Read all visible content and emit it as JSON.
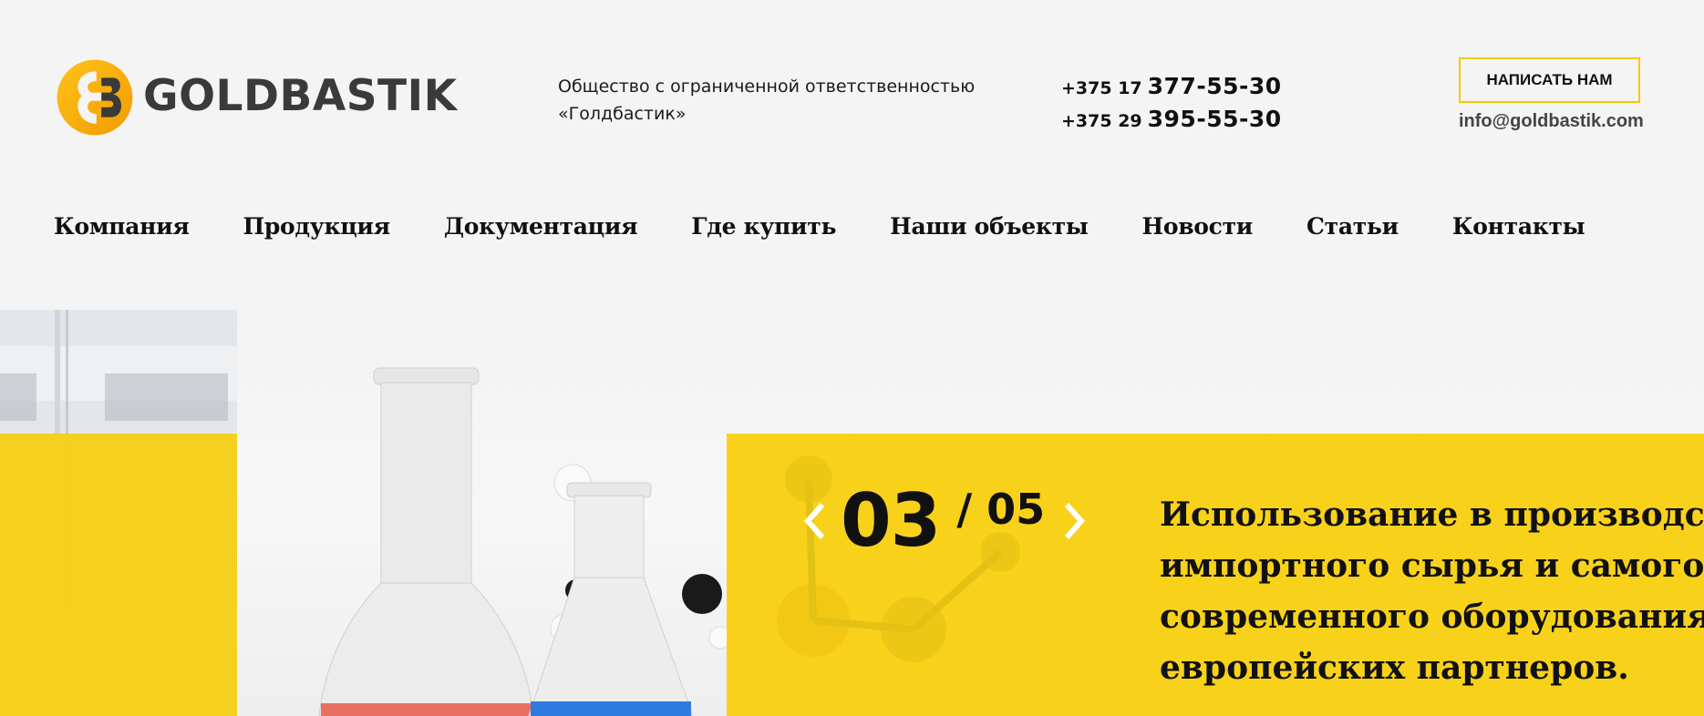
{
  "brand": {
    "logo_text": "GOLDBASTIK",
    "logo_mark_text": "GB"
  },
  "company": {
    "line1": "Общество с ограниченной ответственностью",
    "line2": "«Голдбастик»"
  },
  "contacts": {
    "phones": [
      {
        "code": "+375 17",
        "number": "377-55-30"
      },
      {
        "code": "+375 29",
        "number": "395-55-30"
      }
    ],
    "write_button": "НАПИСАТЬ НАМ",
    "email": "info@goldbastik.com"
  },
  "nav": {
    "items": [
      "Компания",
      "Продукция",
      "Документация",
      "Где купить",
      "Наши объекты",
      "Новости",
      "Статьи",
      "Контакты"
    ]
  },
  "slider": {
    "current": "03",
    "total": "/ 05",
    "text_lines": [
      "Использование в производстве",
      "импортного сырья и самого",
      "современного оборудования от",
      "европейских партнеров."
    ]
  },
  "colors": {
    "accent": "#f8d21a",
    "text": "#111111",
    "background": "#f4f4f4"
  },
  "icons": {
    "logo": "goldbastik-logo-icon",
    "prev": "chevron-left-icon",
    "next": "chevron-right-icon"
  }
}
